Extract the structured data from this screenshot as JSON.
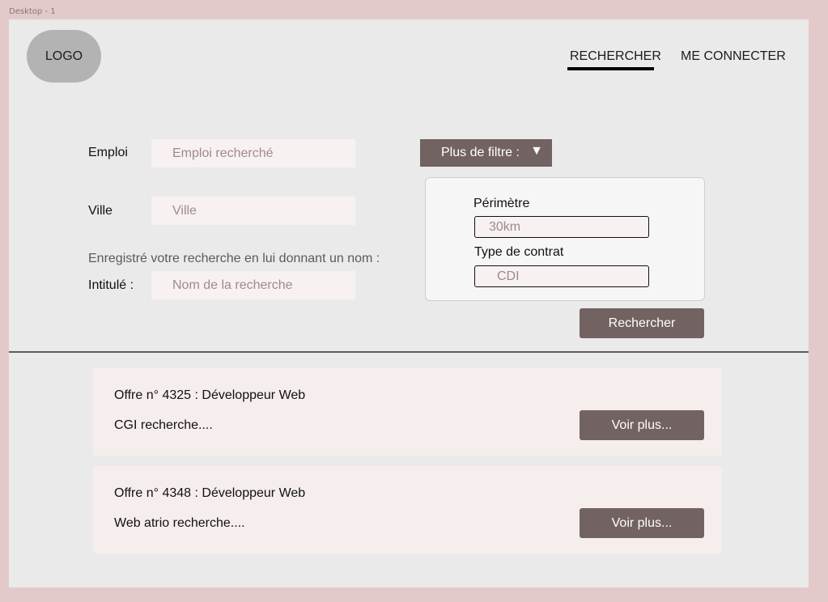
{
  "frame": {
    "label": "Desktop - 1"
  },
  "header": {
    "logo": "LOGO",
    "nav": {
      "search": "RECHERCHER",
      "login": "ME CONNECTER"
    }
  },
  "form": {
    "job_label": "Emploi",
    "job_placeholder": "Emploi recherché",
    "city_label": "Ville",
    "city_placeholder": "Ville",
    "save_hint": "Enregistré votre recherche en lui donnant un nom :",
    "name_label": "Intitulé :",
    "name_placeholder": "Nom de la recherche"
  },
  "filters": {
    "toggle_label": "Plus de filtre :",
    "perimeter_label": "Périmètre",
    "perimeter_value": "30km",
    "contract_label": "Type de contrat",
    "contract_value": "CDI"
  },
  "search_button": "Rechercher",
  "offers": [
    {
      "title": "Offre n° 4325 : Développeur Web",
      "desc": "CGI recherche....",
      "more": "Voir plus..."
    },
    {
      "title": "Offre n° 4348 : Développeur Web",
      "desc": "Web atrio recherche....",
      "more": "Voir plus..."
    }
  ]
}
